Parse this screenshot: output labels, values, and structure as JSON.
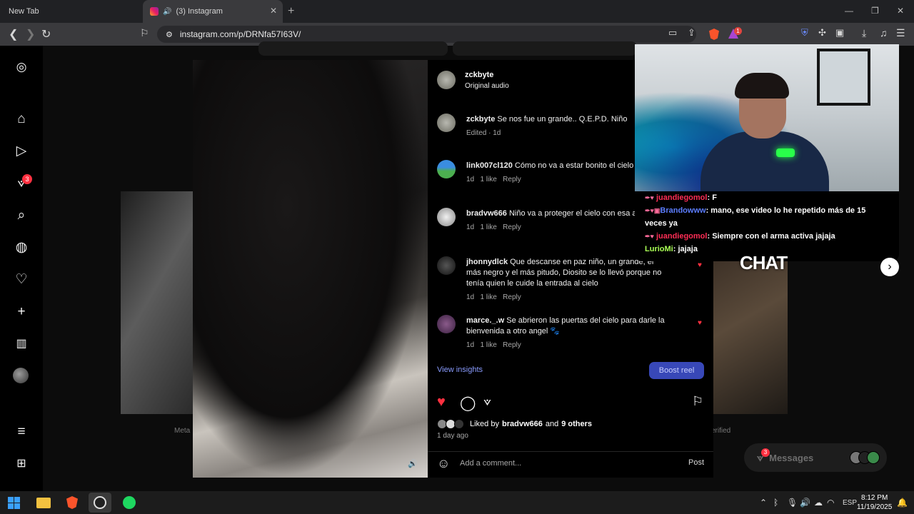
{
  "browser": {
    "tabs": [
      {
        "label": "New Tab"
      },
      {
        "label": "(3) Instagram"
      }
    ],
    "url": "instagram.com/p/DRNfa57I63V/",
    "brave_shield_count": "1"
  },
  "sidebar": {
    "notification_badge": "3"
  },
  "background": {
    "footer_left": "Meta",
    "footer_right": "erified"
  },
  "post": {
    "author": "zckbyte",
    "audio": "Original audio",
    "comments": [
      {
        "user": "zckbyte",
        "text": "Se nos fue un grande.. Q.E.P.D. Niño",
        "meta": "Edited · 1d"
      },
      {
        "user": "link007cl120",
        "text": "Cómo no va a estar bonito el cielo 😔",
        "time": "1d",
        "likes": "1 like",
        "reply": "Reply"
      },
      {
        "user": "bradvw666",
        "text": "Niño va a proteger el cielo con esa a llore n",
        "time": "1d",
        "likes": "1 like",
        "reply": "Reply"
      },
      {
        "user": "jhonnydlck",
        "text": "Que descanse en paz niño, un grande, el más negro y el más pitudo, Diosito se lo llevó porque no tenía quien le cuide la entrada al cielo",
        "time": "1d",
        "likes": "1 like",
        "reply": "Reply"
      },
      {
        "user": "marce._.w",
        "text": "Se abrieron las puertas del cielo para darle la bienvenida a otro angel 🐾",
        "time": "1d",
        "likes": "1 like",
        "reply": "Reply"
      }
    ],
    "view_insights": "View insights",
    "boost": "Boost reel",
    "liked_prefix": "Liked by",
    "liked_user": "bradvw666",
    "liked_and": "and",
    "liked_others": "9 others",
    "time_ago": "1 day ago",
    "comment_placeholder": "Add a comment...",
    "post_button": "Post"
  },
  "stream": {
    "chat": [
      {
        "user": "juandiegomol",
        "text": "F",
        "color": "#ff2d55"
      },
      {
        "user": "Brandowww",
        "text": "mano, ese video lo he repetido más de 15 veces ya",
        "color": "#5c7dff"
      },
      {
        "user": "juandiegomol",
        "text": "Siempre con el arma activa jajaja",
        "color": "#ff2d55"
      },
      {
        "user": "LurioMi",
        "text": "jajaja",
        "color": "#aaff55"
      }
    ],
    "chat_label": "CHAT"
  },
  "messages": {
    "label": "Messages",
    "badge": "3"
  },
  "taskbar": {
    "lang": "ESP",
    "time": "8:12 PM",
    "date": "11/19/2025"
  }
}
